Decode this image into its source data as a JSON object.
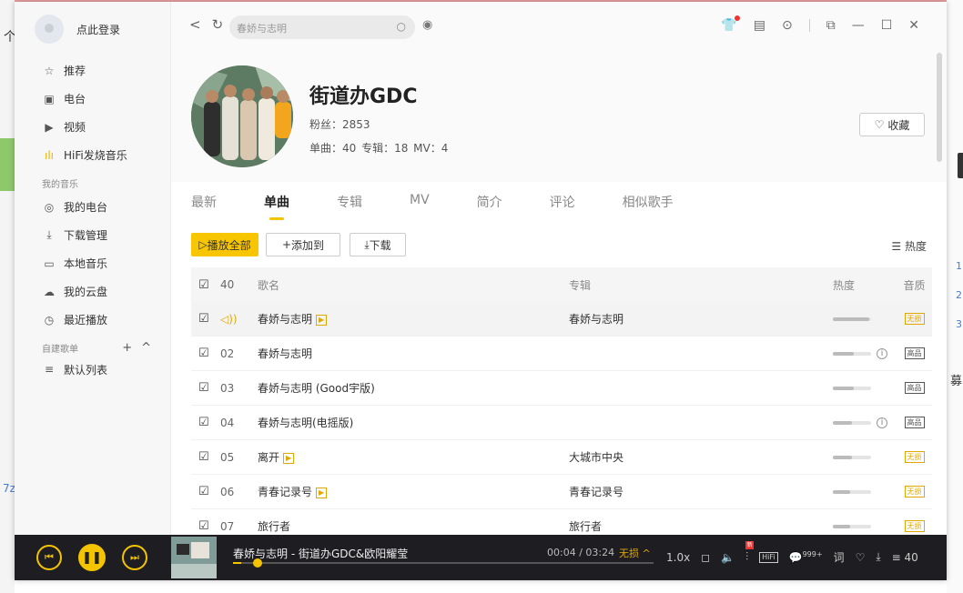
{
  "sidebar": {
    "login_label": "点此登录",
    "items": [
      {
        "label": "推荐",
        "icon": "star-icon",
        "glyph": "☆"
      },
      {
        "label": "电台",
        "icon": "radio-icon",
        "glyph": "▣"
      },
      {
        "label": "视频",
        "icon": "video-icon",
        "glyph": "▶"
      },
      {
        "label": "HiFi发烧音乐",
        "icon": "hifi-icon",
        "glyph": "ılı"
      }
    ],
    "my_music_title": "我的音乐",
    "my_music": [
      {
        "label": "我的电台",
        "icon": "radio-wave-icon",
        "glyph": "◎"
      },
      {
        "label": "下载管理",
        "icon": "download-icon",
        "glyph": "⤓"
      },
      {
        "label": "本地音乐",
        "icon": "computer-icon",
        "glyph": "▭"
      },
      {
        "label": "我的云盘",
        "icon": "cloud-icon",
        "glyph": "☁"
      },
      {
        "label": "最近播放",
        "icon": "clock-icon",
        "glyph": "◷"
      }
    ],
    "playlist_title": "自建歌单",
    "playlists": [
      {
        "label": "默认列表",
        "icon": "list-icon",
        "glyph": "≡"
      }
    ]
  },
  "topbar": {
    "search_placeholder": "春娇与志明"
  },
  "artist": {
    "name": "街道办GDC",
    "fans": "粉丝：2853",
    "stats": "单曲：40   专辑：18   MV：4",
    "fav_label": "收藏"
  },
  "tabs": [
    {
      "label": "最新",
      "active": false
    },
    {
      "label": "单曲",
      "active": true
    },
    {
      "label": "专辑",
      "active": false
    },
    {
      "label": "MV",
      "active": false
    },
    {
      "label": "简介",
      "active": false
    },
    {
      "label": "评论",
      "active": false
    },
    {
      "label": "相似歌手",
      "active": false
    }
  ],
  "actions": {
    "play_all": "播放全部",
    "add_to": "添加到",
    "download": "下载",
    "sort": "热度"
  },
  "table": {
    "count": "40",
    "headers": {
      "name": "歌名",
      "album": "专辑",
      "heat": "热度",
      "quality": "音质"
    },
    "rows": [
      {
        "num": "",
        "name": "春娇与志明",
        "mv": true,
        "album": "春娇与志明",
        "heat": 0.95,
        "info": false,
        "quality": "无损",
        "qtype": "gold",
        "playing": true
      },
      {
        "num": "02",
        "name": "春娇与志明",
        "mv": false,
        "album": "",
        "heat": 0.55,
        "info": true,
        "quality": "高品",
        "qtype": "gray",
        "playing": false
      },
      {
        "num": "03",
        "name": "春娇与志明 (Good宇版)",
        "mv": false,
        "album": "",
        "heat": 0.55,
        "info": false,
        "quality": "高品",
        "qtype": "gray",
        "playing": false
      },
      {
        "num": "04",
        "name": "春娇与志明(电摇版)",
        "mv": false,
        "album": "",
        "heat": 0.5,
        "info": true,
        "quality": "高品",
        "qtype": "gray",
        "playing": false
      },
      {
        "num": "05",
        "name": "离开",
        "mv": true,
        "album": "大城市中央",
        "heat": 0.5,
        "info": false,
        "quality": "无损",
        "qtype": "gold",
        "playing": false
      },
      {
        "num": "06",
        "name": "青春记录号",
        "mv": true,
        "album": "青春记录号",
        "heat": 0.45,
        "info": false,
        "quality": "无损",
        "qtype": "gold",
        "playing": false
      },
      {
        "num": "07",
        "name": "旅行者",
        "mv": false,
        "album": "旅行者",
        "heat": 0.45,
        "info": false,
        "quality": "无损",
        "qtype": "gold",
        "playing": false
      }
    ]
  },
  "player": {
    "now_playing": "春娇与志明 - 街道办GDC&欧阳耀莹",
    "time": "00:04 / 03:24",
    "quality": "无损",
    "speed": "1.0x",
    "hifi": "HiFi",
    "comments": "999+",
    "playlist_count": "40",
    "progress": 0.02,
    "eq_badge": "新"
  },
  "background": {
    "left_char": "个",
    "left_text": "7z",
    "right_nums": [
      "1",
      "2",
      "3"
    ],
    "right_char": "募"
  },
  "colors": {
    "accent": "#f5c400",
    "player_bg": "#1e1e22"
  }
}
